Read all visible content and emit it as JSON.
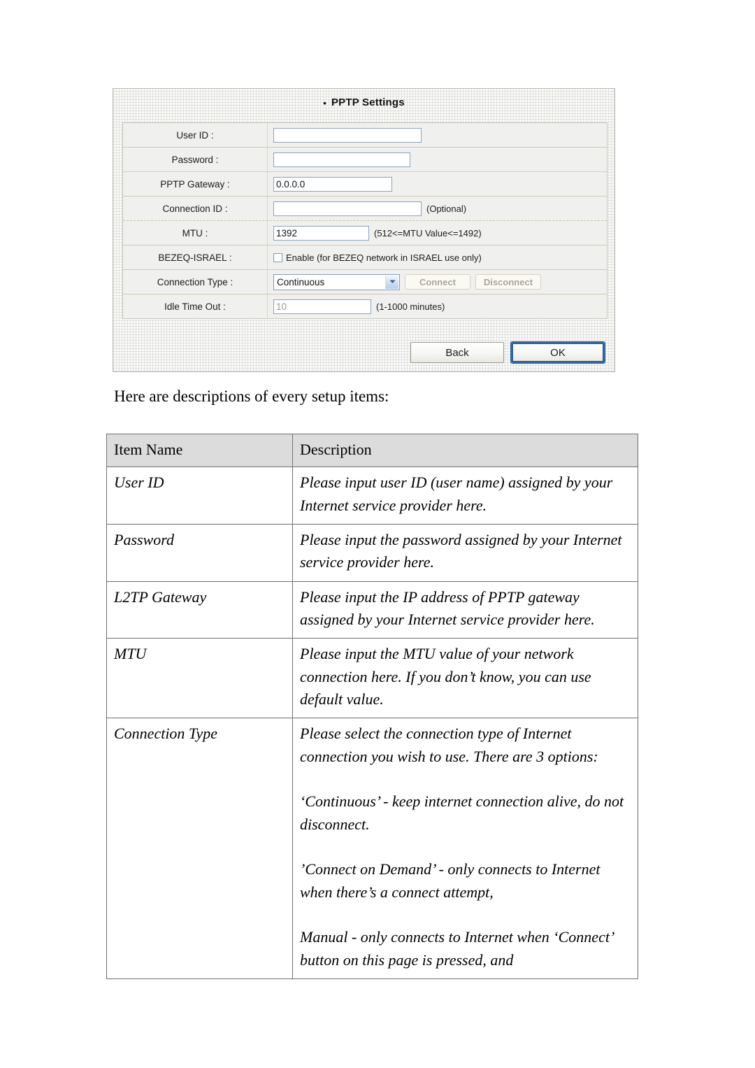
{
  "screenshot": {
    "title": "PPTP Settings",
    "bullet_glyph": "•",
    "rows": [
      {
        "label": "User ID :",
        "value": "",
        "hint": ""
      },
      {
        "label": "Password :",
        "value": "",
        "hint": ""
      },
      {
        "label": "PPTP Gateway :",
        "value": "0.0.0.0",
        "hint": ""
      },
      {
        "label": "Connection ID :",
        "value": "",
        "hint": "(Optional)"
      },
      {
        "label": "MTU :",
        "value": "1392",
        "hint": "(512<=MTU Value<=1492)"
      },
      {
        "label": "BEZEQ-ISRAEL :",
        "value": "",
        "hint": "Enable (for BEZEQ network in ISRAEL use only)"
      },
      {
        "label": "Connection Type :",
        "value": "Continuous",
        "hint": ""
      },
      {
        "label": "Idle Time Out :",
        "value": "10",
        "hint": "(1-1000 minutes)"
      }
    ],
    "connection_type_selected": "Continuous",
    "connect_button": "Connect",
    "disconnect_button": "Disconnect",
    "back_button": "Back",
    "ok_button": "OK",
    "colors": {
      "field_border": "#8ba3bd",
      "focus_border": "#2b5f9e",
      "row_background": "#f0f0ee",
      "dropdown_arrow": "#3c6ea8"
    }
  },
  "document": {
    "lead_text": "Here are descriptions of every setup items:",
    "table": {
      "headers": [
        "Item Name",
        "Description"
      ],
      "rows": [
        {
          "item": "User ID",
          "paragraphs": [
            {
              "text": "Please input user ID (user name) assigned by your Internet service provider here.",
              "gap": false
            }
          ]
        },
        {
          "item": "Password",
          "paragraphs": [
            {
              "text": "Please input the password assigned by your Internet service provider here.",
              "gap": false
            }
          ]
        },
        {
          "item": "L2TP Gateway",
          "paragraphs": [
            {
              "text": "Please input the IP address of PPTP gateway assigned by your Internet service provider here.",
              "gap": false
            }
          ]
        },
        {
          "item": "MTU",
          "paragraphs": [
            {
              "text": "Please input the MTU value of your network connection here. If you don’t know, you can use default value.",
              "gap": false
            }
          ]
        },
        {
          "item": "Connection Type",
          "paragraphs": [
            {
              "text": "Please select the connection type of Internet connection you wish to use. There are 3 options:",
              "gap": false
            },
            {
              "text": "‘Continuous’ - keep internet connection alive, do not disconnect.",
              "gap": true
            },
            {
              "text": "’Connect on Demand’ - only connects to Internet when there’s a connect attempt,",
              "gap": true
            },
            {
              "text": "Manual - only connects to Internet when ‘Connect’ button on this page is pressed, and",
              "gap": true
            }
          ]
        }
      ]
    }
  }
}
